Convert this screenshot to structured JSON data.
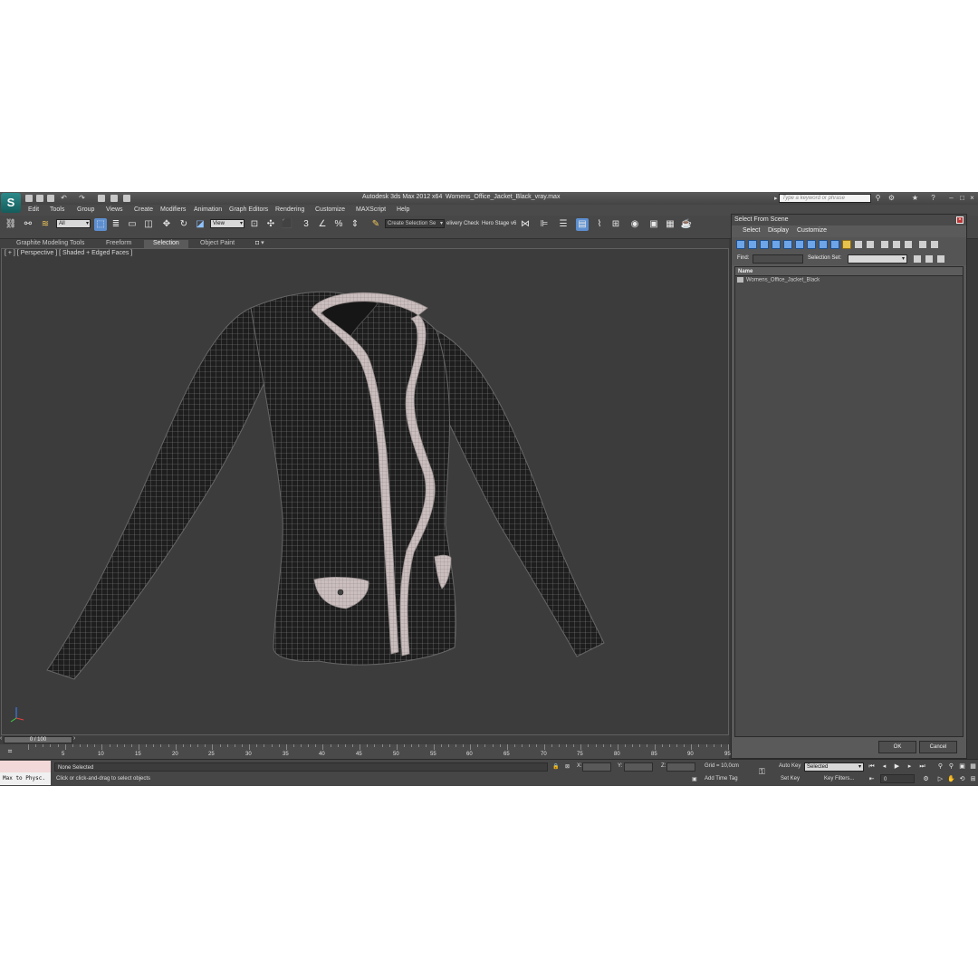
{
  "titlebar": {
    "app_title": "Autodesk 3ds Max  2012 x64",
    "file_name": "Womens_Office_Jacket_Black_vray.max",
    "search_placeholder": "Type a keyword or phrase"
  },
  "menu": [
    "Edit",
    "Tools",
    "Group",
    "Views",
    "Create",
    "Modifiers",
    "Animation",
    "Graph Editors",
    "Rendering",
    "Customize",
    "MAXScript",
    "Help"
  ],
  "toolbar": {
    "filter_value": "All",
    "coord_system": "View",
    "selection_set_placeholder": "Create Selection Se",
    "delivery_check": "elivery Check",
    "hero_stage": "Hero Stage v6"
  },
  "ribbon_tabs": [
    "Graphite Modeling Tools",
    "Freeform",
    "Selection",
    "Object Paint"
  ],
  "viewport": {
    "label": "[ + ] [ Perspective ] [ Shaded + Edged Faces ]"
  },
  "timeline": {
    "frame_display": "0 / 100",
    "ticks": [
      "5",
      "10",
      "15",
      "20",
      "25",
      "30",
      "35",
      "40",
      "45",
      "50",
      "55",
      "60",
      "65",
      "70",
      "75",
      "80",
      "85",
      "90",
      "95"
    ]
  },
  "status": {
    "maxscript_label": "Max to Physc.",
    "selection_status": "None Selected",
    "prompt": "Click or click-and-drag to select objects",
    "x_label": "X:",
    "y_label": "Y:",
    "z_label": "Z:",
    "grid": "Grid = 10,0cm",
    "add_time_tag": "Add Time Tag",
    "auto_key": "Auto Key",
    "set_key": "Set Key",
    "selected_value": "Selected",
    "key_filters": "Key Filters...",
    "frame_value": "0"
  },
  "dialog": {
    "title": "Select From Scene",
    "menu": [
      "Select",
      "Display",
      "Customize"
    ],
    "find_label": "Find:",
    "selection_set_label": "Selection Set:",
    "column_name": "Name",
    "items": [
      "Womens_Office_Jacket_Black"
    ],
    "ok_label": "OK",
    "cancel_label": "Cancel"
  },
  "colors": {
    "viewport_bg": "#3c3c3c",
    "jacket_fill": "#1e1e1e",
    "wire": "#8a8a8a",
    "trim": "#c9bcbc",
    "accent": "#5d8fd0"
  },
  "icons": [
    "app-logo-icon",
    "new-file-icon",
    "open-file-icon",
    "save-icon",
    "undo-icon",
    "redo-icon",
    "search-icon",
    "select-object-icon",
    "move-icon",
    "rotate-icon",
    "scale-icon",
    "snap-icon",
    "mirror-icon",
    "align-icon",
    "render-icon",
    "teapot-icon",
    "play-icon",
    "key-icon"
  ]
}
